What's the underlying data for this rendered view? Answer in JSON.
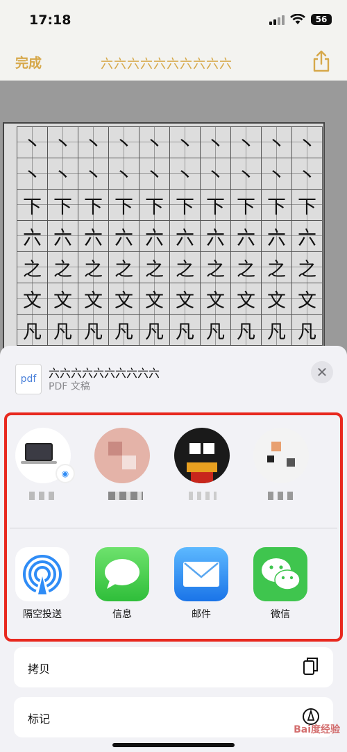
{
  "status": {
    "time": "17:18",
    "battery": "56"
  },
  "nav": {
    "done_label": "完成",
    "title": "六六六六六六六六六六"
  },
  "document": {
    "rows": [
      [
        "丶",
        "丶",
        "丶",
        "丶",
        "丶",
        "丶",
        "丶",
        "丶",
        "丶",
        "丶"
      ],
      [
        "丶",
        "丶",
        "丶",
        "丶",
        "丶",
        "丶",
        "丶",
        "丶",
        "丶",
        "丶"
      ],
      [
        "下",
        "下",
        "下",
        "下",
        "下",
        "下",
        "下",
        "下",
        "下",
        "下"
      ],
      [
        "六",
        "六",
        "六",
        "六",
        "六",
        "六",
        "六",
        "六",
        "六",
        "六"
      ],
      [
        "之",
        "之",
        "之",
        "之",
        "之",
        "之",
        "之",
        "之",
        "之",
        "之"
      ],
      [
        "文",
        "文",
        "文",
        "文",
        "文",
        "文",
        "文",
        "文",
        "文",
        "文"
      ],
      [
        "凡",
        "凡",
        "凡",
        "凡",
        "凡",
        "凡",
        "凡",
        "凡",
        "凡",
        "凡"
      ]
    ]
  },
  "share_sheet": {
    "file_icon_text": "pdf",
    "file_name": "六六六六六六六六六六",
    "file_type": "PDF 文稿",
    "apps": [
      {
        "label": "隔空投送",
        "icon": "airdrop-icon"
      },
      {
        "label": "信息",
        "icon": "messages-icon"
      },
      {
        "label": "邮件",
        "icon": "mail-icon"
      },
      {
        "label": "微信",
        "icon": "wechat-icon"
      }
    ],
    "actions": [
      {
        "label": "拷贝",
        "icon": "copy-icon"
      },
      {
        "label": "标记",
        "icon": "markup-icon"
      }
    ]
  },
  "colors": {
    "accent": "#d6a84a",
    "highlight": "#e8291f"
  },
  "watermark": "Bai度经验"
}
